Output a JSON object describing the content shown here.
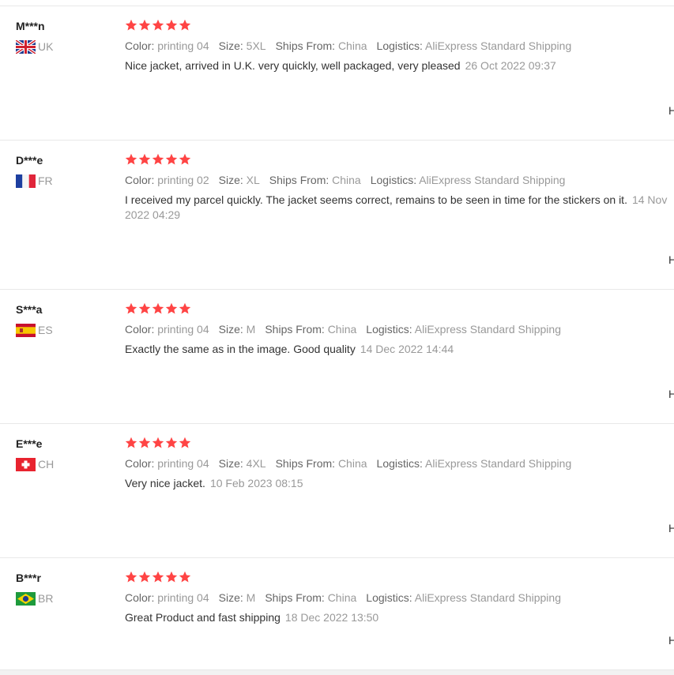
{
  "labels": {
    "color": "Color:",
    "size": "Size:",
    "ships_from": "Ships From:",
    "logistics": "Logistics:",
    "helpful": "H"
  },
  "colors": {
    "star": "#f44",
    "text_muted": "#999"
  },
  "reviews": [
    {
      "name": "M***n",
      "country_code": "UK",
      "flag_icon": "flag-uk-icon",
      "rating": 5,
      "color": "printing 04",
      "size": "5XL",
      "ships_from": "China",
      "logistics": "AliExpress Standard Shipping",
      "text": "Nice jacket, arrived in U.K. very quickly, well packaged, very pleased",
      "date": "26 Oct 2022 09:37"
    },
    {
      "name": "D***e",
      "country_code": "FR",
      "flag_icon": "flag-fr-icon",
      "rating": 5,
      "color": "printing 02",
      "size": "XL",
      "ships_from": "China",
      "logistics": "AliExpress Standard Shipping",
      "text": "I received my parcel quickly. The jacket seems correct, remains to be seen in time for the stickers on it.",
      "date": "14 Nov 2022 04:29"
    },
    {
      "name": "S***a",
      "country_code": "ES",
      "flag_icon": "flag-es-icon",
      "rating": 5,
      "color": "printing 04",
      "size": "M",
      "ships_from": "China",
      "logistics": "AliExpress Standard Shipping",
      "text": "Exactly the same as in the image. Good quality",
      "date": "14 Dec 2022 14:44"
    },
    {
      "name": "E***e",
      "country_code": "CH",
      "flag_icon": "flag-ch-icon",
      "rating": 5,
      "color": "printing 04",
      "size": "4XL",
      "ships_from": "China",
      "logistics": "AliExpress Standard Shipping",
      "text": "Very nice jacket.",
      "date": "10 Feb 2023 08:15"
    },
    {
      "name": "B***r",
      "country_code": "BR",
      "flag_icon": "flag-br-icon",
      "rating": 5,
      "color": "printing 04",
      "size": "M",
      "ships_from": "China",
      "logistics": "AliExpress Standard Shipping",
      "text": "Great Product and fast shipping",
      "date": "18 Dec 2022 13:50"
    }
  ]
}
